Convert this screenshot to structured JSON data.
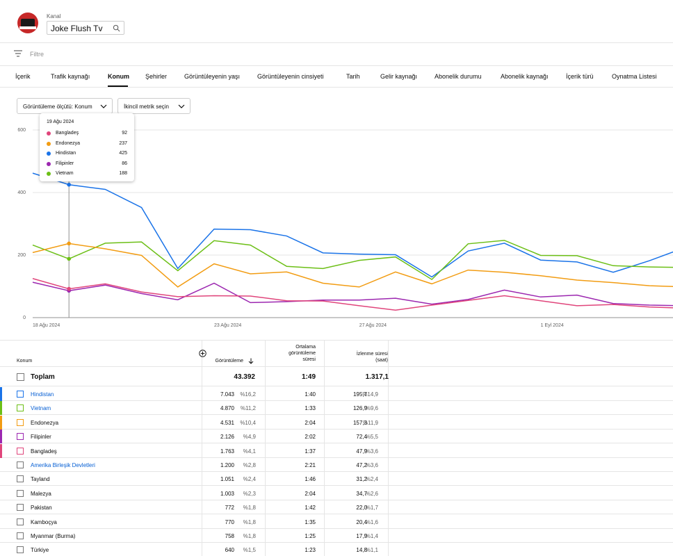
{
  "header": {
    "kanal_label": "Kanal",
    "channel_name": "Joke Flush Tv",
    "filter_label": "Filtre"
  },
  "tabs": [
    {
      "label": "İçerik"
    },
    {
      "label": "Trafik kaynağı"
    },
    {
      "label": "Konum",
      "active": true
    },
    {
      "label": "Şehirler"
    },
    {
      "label": "Görüntüleyenin yaşı"
    },
    {
      "label": "Görüntüleyenin cinsiyeti"
    },
    {
      "label": "Tarih"
    },
    {
      "label": "Gelir kaynağı"
    },
    {
      "label": "Abonelik durumu"
    },
    {
      "label": "Abonelik kaynağı"
    },
    {
      "label": "İçerik türü"
    },
    {
      "label": "Oynatma Listesi"
    }
  ],
  "controls": {
    "metric_dropdown": "Görüntüleme ölçütü: Konum",
    "secondary_dropdown": "İkincil metrik seçin"
  },
  "tooltip": {
    "date": "19 Ağu 2024",
    "rows": [
      {
        "name": "Bangladeş",
        "value": "92",
        "color": "#e0457b"
      },
      {
        "name": "Endonezya",
        "value": "237",
        "color": "#f29c12"
      },
      {
        "name": "Hindistan",
        "value": "425",
        "color": "#1a73e8"
      },
      {
        "name": "Filipinler",
        "value": "86",
        "color": "#9c27b0"
      },
      {
        "name": "Vietnam",
        "value": "188",
        "color": "#6cbf16"
      }
    ]
  },
  "chart_data": {
    "type": "line",
    "y_ticks": [
      "600",
      "400",
      "200",
      "0"
    ],
    "ylim": [
      0,
      600
    ],
    "x_tick_labels": [
      {
        "label": "18 Ağu 2024",
        "index": 0
      },
      {
        "label": "23 Ağu 2024",
        "index": 5
      },
      {
        "label": "27 Ağu 2024",
        "index": 9
      },
      {
        "label": "1 Eyl 2024",
        "index": 14
      }
    ],
    "x_count": 19,
    "hover_index": 1,
    "series": [
      {
        "name": "Hindistan",
        "color": "#1a73e8",
        "values": [
          462,
          425,
          410,
          352,
          157,
          283,
          281,
          261,
          207,
          203,
          201,
          130,
          213,
          238,
          184,
          178,
          145,
          182,
          225
        ]
      },
      {
        "name": "Vietnam",
        "color": "#6cbf16",
        "values": [
          232,
          188,
          238,
          242,
          150,
          246,
          232,
          164,
          157,
          183,
          194,
          122,
          236,
          247,
          199,
          198,
          166,
          162,
          160
        ]
      },
      {
        "name": "Endonezya",
        "color": "#f29c12",
        "values": [
          208,
          237,
          220,
          199,
          98,
          172,
          140,
          146,
          110,
          98,
          146,
          108,
          152,
          145,
          134,
          120,
          112,
          102,
          98
        ]
      },
      {
        "name": "Filipinler",
        "color": "#9c27b0",
        "values": [
          113,
          86,
          104,
          77,
          57,
          110,
          48,
          51,
          56,
          56,
          62,
          43,
          58,
          88,
          66,
          72,
          45,
          40,
          38
        ]
      },
      {
        "name": "Bangladeş",
        "color": "#e0457b",
        "values": [
          125,
          92,
          108,
          82,
          67,
          70,
          69,
          54,
          53,
          38,
          24,
          40,
          55,
          70,
          54,
          38,
          42,
          34,
          30
        ]
      }
    ]
  },
  "table": {
    "headers": {
      "konum": "Konum",
      "goruntuleme": "Görüntüleme",
      "ortalama": [
        "Ortalama",
        "görüntüleme",
        "süresi"
      ],
      "izlenme": [
        "İzlenme süresi",
        "(saat)"
      ]
    },
    "total": {
      "label": "Toplam",
      "views": "43.392",
      "avg": "1:49",
      "watch": "1.317,1"
    },
    "rows": [
      {
        "name": "Hindistan",
        "views": "7.043",
        "vpct": "%16,2",
        "avg": "1:40",
        "watch": "195,7",
        "wpct": "%14,9",
        "color": "#1a73e8",
        "link": true
      },
      {
        "name": "Vietnam",
        "views": "4.870",
        "vpct": "%11,2",
        "avg": "1:33",
        "watch": "126,9",
        "wpct": "%9,6",
        "color": "#6cbf16",
        "link": true
      },
      {
        "name": "Endonezya",
        "views": "4.531",
        "vpct": "%10,4",
        "avg": "2:04",
        "watch": "157,3",
        "wpct": "%11,9",
        "color": "#f29c12",
        "link": false
      },
      {
        "name": "Filipinler",
        "views": "2.126",
        "vpct": "%4,9",
        "avg": "2:02",
        "watch": "72,4",
        "wpct": "%5,5",
        "color": "#9c27b0",
        "link": false
      },
      {
        "name": "Bangladeş",
        "views": "1.763",
        "vpct": "%4,1",
        "avg": "1:37",
        "watch": "47,9",
        "wpct": "%3,6",
        "color": "#e0457b",
        "link": false
      },
      {
        "name": "Amerika Birleşik Devletleri",
        "views": "1.200",
        "vpct": "%2,8",
        "avg": "2:21",
        "watch": "47,2",
        "wpct": "%3,6",
        "color": "",
        "link": true
      },
      {
        "name": "Tayland",
        "views": "1.051",
        "vpct": "%2,4",
        "avg": "1:46",
        "watch": "31,2",
        "wpct": "%2,4",
        "color": "",
        "link": false
      },
      {
        "name": "Malezya",
        "views": "1.003",
        "vpct": "%2,3",
        "avg": "2:04",
        "watch": "34,7",
        "wpct": "%2,6",
        "color": "",
        "link": false
      },
      {
        "name": "Pakistan",
        "views": "772",
        "vpct": "%1,8",
        "avg": "1:42",
        "watch": "22,0",
        "wpct": "%1,7",
        "color": "",
        "link": false
      },
      {
        "name": "Kamboçya",
        "views": "770",
        "vpct": "%1,8",
        "avg": "1:35",
        "watch": "20,4",
        "wpct": "%1,6",
        "color": "",
        "link": false
      },
      {
        "name": "Myanmar (Burma)",
        "views": "758",
        "vpct": "%1,8",
        "avg": "1:25",
        "watch": "17,9",
        "wpct": "%1,4",
        "color": "",
        "link": false
      },
      {
        "name": "Türkiye",
        "views": "640",
        "vpct": "%1,5",
        "avg": "1:23",
        "watch": "14,8",
        "wpct": "%1,1",
        "color": "",
        "link": false
      }
    ]
  }
}
